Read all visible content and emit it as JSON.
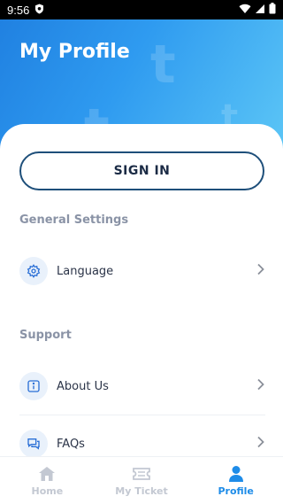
{
  "status_bar": {
    "time": "9:56"
  },
  "header": {
    "title": "My Profile"
  },
  "sign_in": {
    "label": "SIGN IN"
  },
  "general_settings": {
    "title": "General Settings",
    "items": [
      {
        "label": "Language",
        "icon": "gear-icon"
      }
    ]
  },
  "support": {
    "title": "Support",
    "items": [
      {
        "label": "About Us",
        "icon": "info-icon"
      },
      {
        "label": "FAQs",
        "icon": "question-chat-icon"
      }
    ]
  },
  "bottom_nav": {
    "items": [
      {
        "label": "Home",
        "icon": "home-icon",
        "active": false
      },
      {
        "label": "My Ticket",
        "icon": "ticket-icon",
        "active": false
      },
      {
        "label": "Profile",
        "icon": "user-icon",
        "active": true
      }
    ]
  },
  "colors": {
    "accent": "#1e8ce8",
    "header_gradient_start": "#1f7fe0",
    "header_gradient_end": "#5cc6f6",
    "button_border": "#1e4f7a",
    "inactive_nav": "#c3c8d2"
  }
}
